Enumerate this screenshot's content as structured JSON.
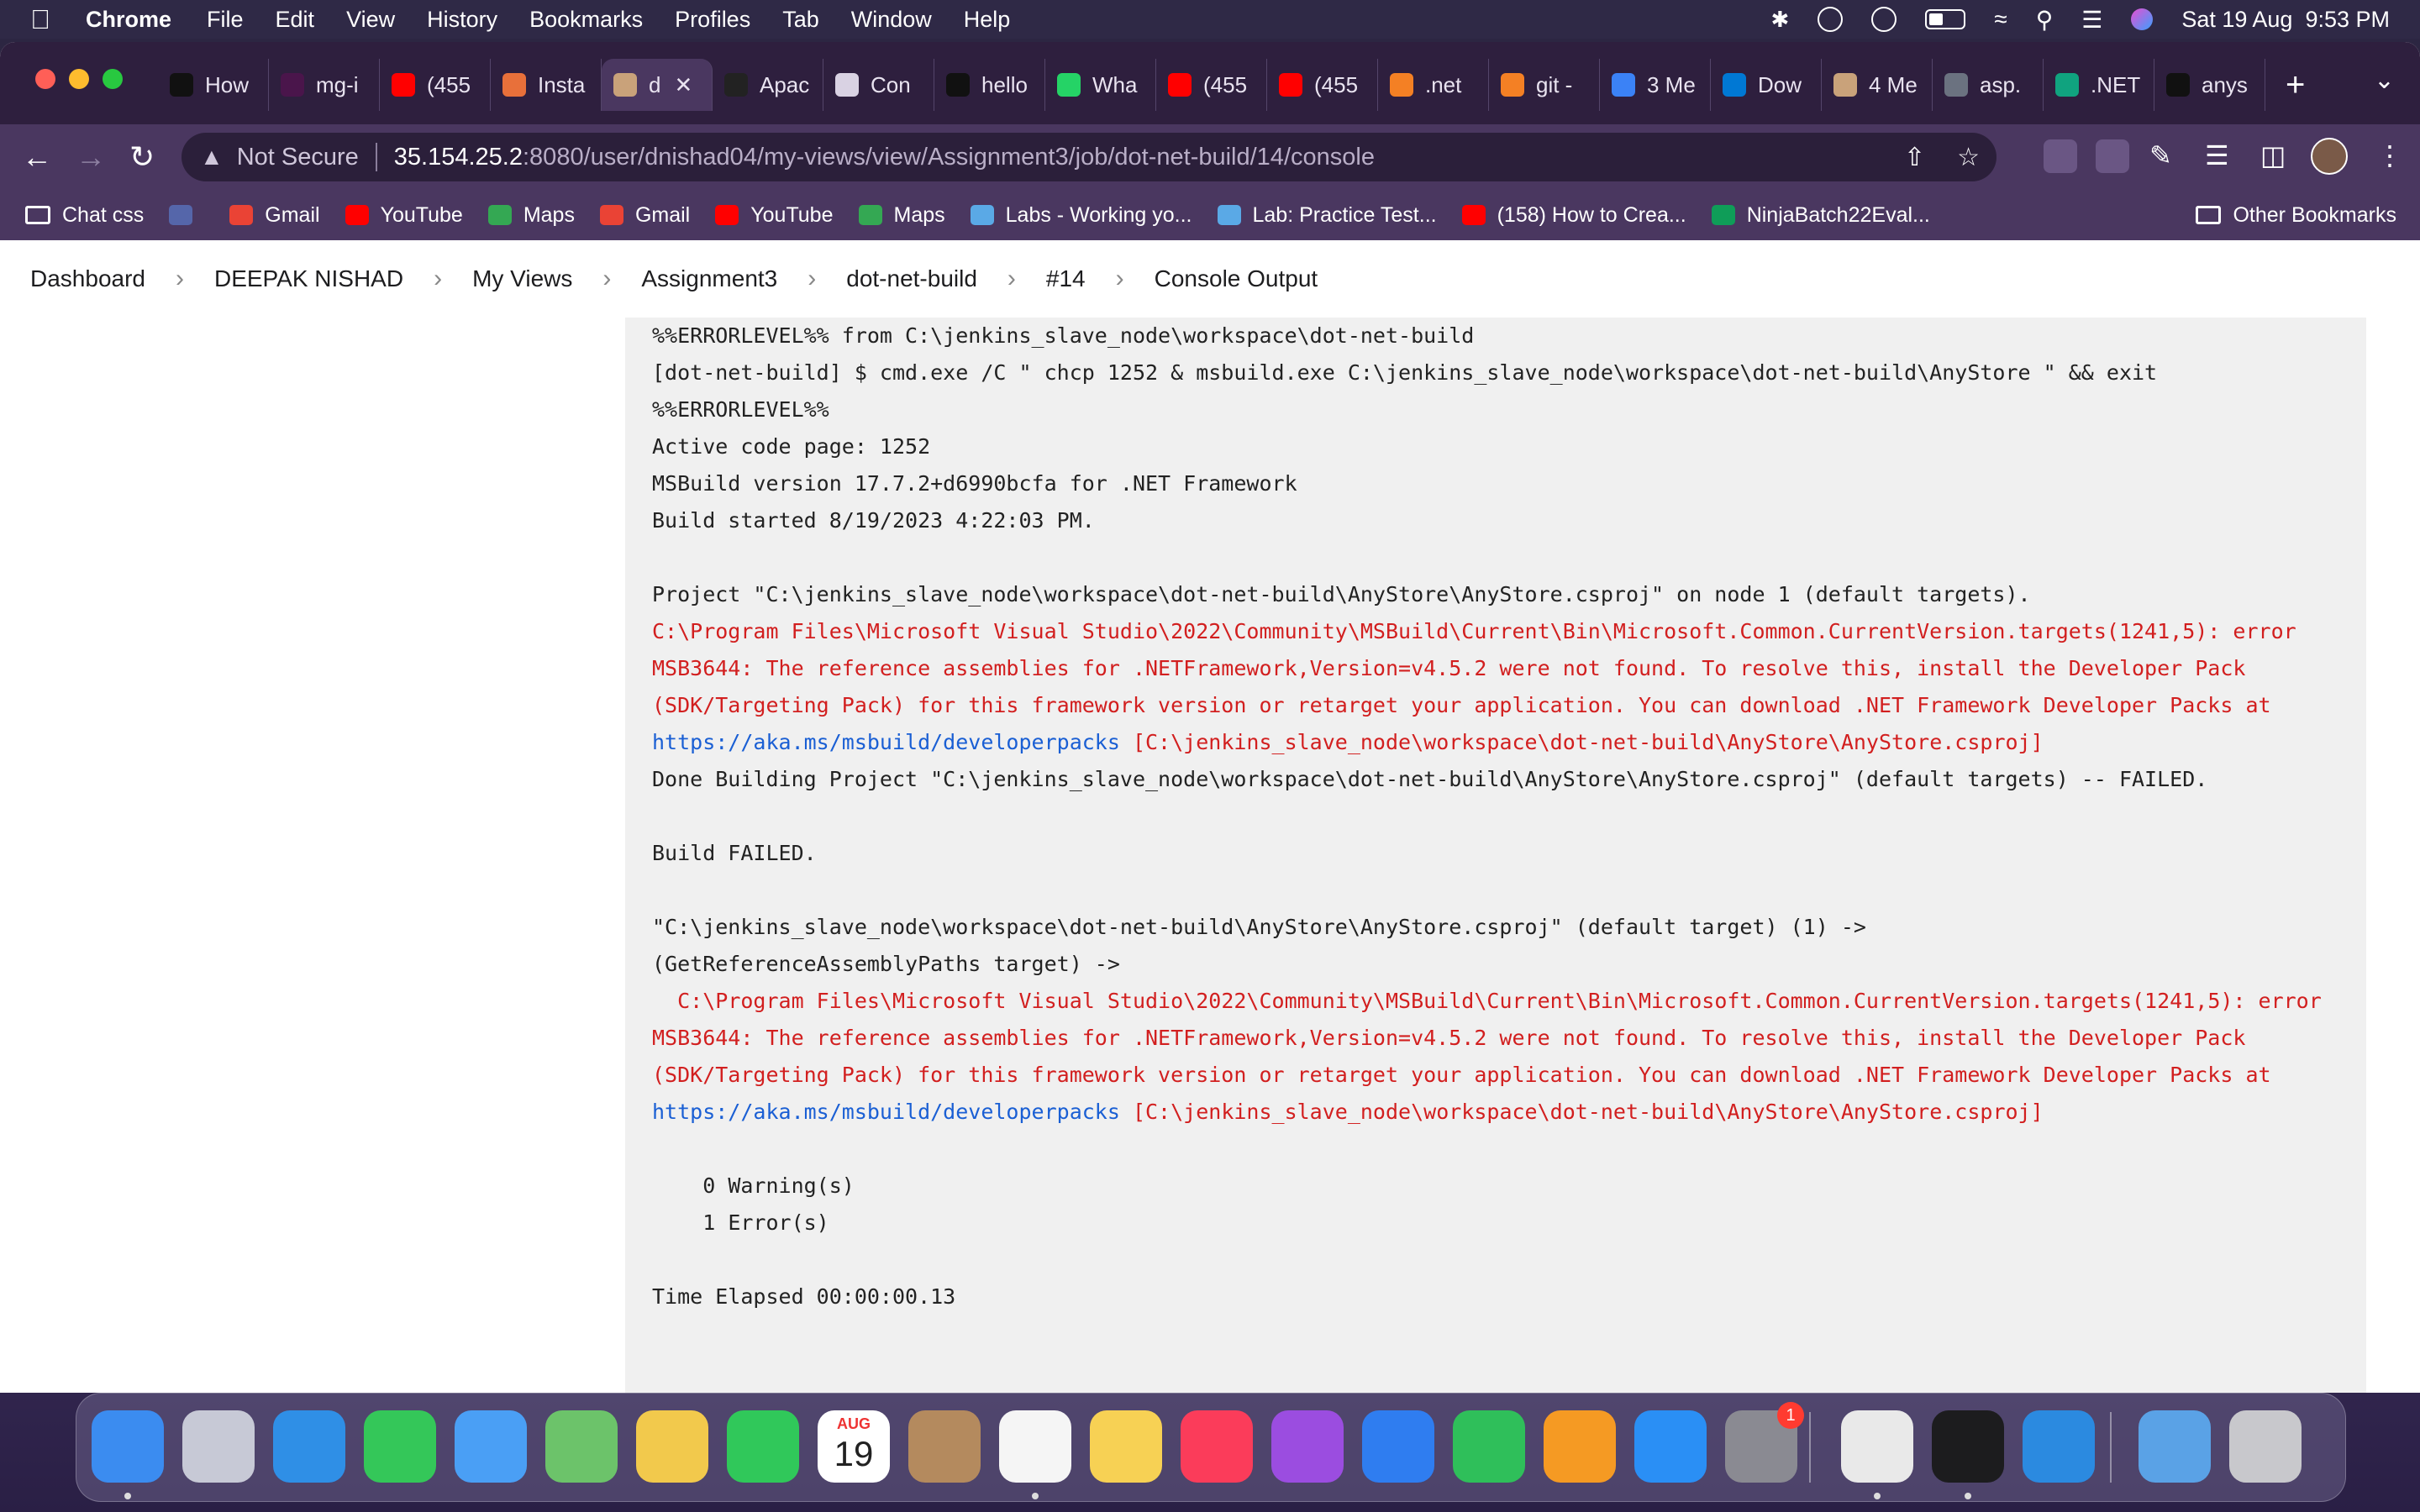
{
  "menubar": {
    "app": "Chrome",
    "items": [
      "File",
      "Edit",
      "View",
      "History",
      "Bookmarks",
      "Profiles",
      "Tab",
      "Window",
      "Help"
    ],
    "clock": "Sat 19 Aug  9:53 PM"
  },
  "tabs": [
    {
      "label": "How",
      "color": "#111111"
    },
    {
      "label": "mg-i",
      "color": "#4a154b"
    },
    {
      "label": "(455",
      "color": "#ff0000"
    },
    {
      "label": "Insta",
      "color": "#e8703a"
    },
    {
      "label": "d",
      "color": "#c9a27a",
      "active": true
    },
    {
      "label": "Apac",
      "color": "#222222"
    },
    {
      "label": "Con",
      "color": "#d9d2e3"
    },
    {
      "label": "hello",
      "color": "#111111"
    },
    {
      "label": "Wha",
      "color": "#25d366"
    },
    {
      "label": "(455",
      "color": "#ff0000"
    },
    {
      "label": "(455",
      "color": "#ff0000"
    },
    {
      "label": ".net",
      "color": "#f48024"
    },
    {
      "label": "git -",
      "color": "#f48024"
    },
    {
      "label": "3 Me",
      "color": "#3b82f6"
    },
    {
      "label": "Dow",
      "color": "#0078d4"
    },
    {
      "label": "4 Me",
      "color": "#c9a27a"
    },
    {
      "label": "asp.",
      "color": "#6b7280"
    },
    {
      "label": ".NET",
      "color": "#10a37f"
    },
    {
      "label": "anys",
      "color": "#111111"
    }
  ],
  "tab_close": "✕",
  "new_tab": "+",
  "address": {
    "security": "Not Secure",
    "host": "35.154.25.2",
    "path": ":8080/user/dnishad04/my-views/view/Assignment3/job/dot-net-build/14/console"
  },
  "bookmarks": [
    {
      "label": "Chat css",
      "color": "folder"
    },
    {
      "label": "",
      "color": "#5566aa"
    },
    {
      "label": "Gmail",
      "color": "#ea4335"
    },
    {
      "label": "YouTube",
      "color": "#ff0000"
    },
    {
      "label": "Maps",
      "color": "#34a853"
    },
    {
      "label": "Gmail",
      "color": "#ea4335"
    },
    {
      "label": "YouTube",
      "color": "#ff0000"
    },
    {
      "label": "Maps",
      "color": "#34a853"
    },
    {
      "label": "Labs - Working yo...",
      "color": "#5aa9e6"
    },
    {
      "label": "Lab: Practice Test...",
      "color": "#5aa9e6"
    },
    {
      "label": "(158) How to Crea...",
      "color": "#ff0000"
    },
    {
      "label": "NinjaBatch22Eval...",
      "color": "#0f9d58"
    }
  ],
  "other_bookmarks": "Other Bookmarks",
  "breadcrumb": [
    "Dashboard",
    "DEEPAK NISHAD",
    "My Views",
    "Assignment3",
    "dot-net-build",
    "#14",
    "Console Output"
  ],
  "console": {
    "l1": "%%ERRORLEVEL%% from C:\\jenkins_slave_node\\workspace\\dot-net-build",
    "l2": "[dot-net-build] $ cmd.exe /C \" chcp 1252 & msbuild.exe C:\\jenkins_slave_node\\workspace\\dot-net-build\\AnyStore \" && exit",
    "l3": "%%ERRORLEVEL%%",
    "l4": "Active code page: 1252",
    "l5": "MSBuild version 17.7.2+d6990bcfa for .NET Framework",
    "l6": "Build started 8/19/2023 4:22:03 PM.",
    "l7": "Project \"C:\\jenkins_slave_node\\workspace\\dot-net-build\\AnyStore\\AnyStore.csproj\" on node 1 (default targets).",
    "e1a": "C:\\Program Files\\Microsoft Visual Studio\\2022\\Community\\MSBuild\\Current\\Bin\\Microsoft.Common.CurrentVersion.targets(1241,5): error MSB3644: The reference assemblies for .NETFramework,Version=v4.5.2 were not found. To resolve this, install the Developer Pack (SDK/Targeting Pack) for this framework version or retarget your application. You can download .NET Framework Developer Packs at ",
    "e1link": "https://aka.ms/msbuild/developerpacks",
    "e1b": " [C:\\jenkins_slave_node\\workspace\\dot-net-build\\AnyStore\\AnyStore.csproj]",
    "l8": "Done Building Project \"C:\\jenkins_slave_node\\workspace\\dot-net-build\\AnyStore\\AnyStore.csproj\" (default targets) -- FAILED.",
    "l9": "Build FAILED.",
    "l10": "\"C:\\jenkins_slave_node\\workspace\\dot-net-build\\AnyStore\\AnyStore.csproj\" (default target) (1) ->",
    "l11": "(GetReferenceAssemblyPaths target) ->",
    "e2a": "  C:\\Program Files\\Microsoft Visual Studio\\2022\\Community\\MSBuild\\Current\\Bin\\Microsoft.Common.CurrentVersion.targets(1241,5): error MSB3644: The reference assemblies for .NETFramework,Version=v4.5.2 were not found. To resolve this, install the Developer Pack (SDK/Targeting Pack) for this framework version or retarget your application. You can download .NET Framework Developer Packs at ",
    "e2link": "https://aka.ms/msbuild/developerpacks",
    "e2b": " [C:\\jenkins_slave_node\\workspace\\dot-net-build\\AnyStore\\AnyStore.csproj]",
    "l12": "    0 Warning(s)",
    "l13": "    1 Error(s)",
    "l14": "Time Elapsed 00:00:00.13"
  },
  "dock": {
    "apps": [
      {
        "name": "finder",
        "color": "#3b8cf0"
      },
      {
        "name": "launchpad",
        "color": "#c7c9d6"
      },
      {
        "name": "safari",
        "color": "#2f8fe6"
      },
      {
        "name": "messages",
        "color": "#34c759"
      },
      {
        "name": "mail",
        "color": "#4a9ff5"
      },
      {
        "name": "maps",
        "color": "#6cc36a"
      },
      {
        "name": "photos",
        "color": "#f2c94c"
      },
      {
        "name": "facetime",
        "color": "#30c85a"
      },
      {
        "name": "calendar",
        "color": "#ffffff"
      },
      {
        "name": "contacts",
        "color": "#b48a5e"
      },
      {
        "name": "reminders",
        "color": "#f5f5f5"
      },
      {
        "name": "notes",
        "color": "#f7d154"
      },
      {
        "name": "music",
        "color": "#fb3c5a"
      },
      {
        "name": "podcasts",
        "color": "#9b4de0"
      },
      {
        "name": "keynote",
        "color": "#2f7df0"
      },
      {
        "name": "numbers",
        "color": "#2fbf5a"
      },
      {
        "name": "pages",
        "color": "#f59a23"
      },
      {
        "name": "app-store",
        "color": "#2a8ff5"
      },
      {
        "name": "system-settings",
        "color": "#8a8a92"
      },
      {
        "name": "chrome",
        "color": "#e9e9e9"
      },
      {
        "name": "terminal",
        "color": "#1c1c1e"
      },
      {
        "name": "vscode",
        "color": "#2b8ae0"
      },
      {
        "name": "downloads",
        "color": "#5aa2e6"
      },
      {
        "name": "trash",
        "color": "#c8c8cc"
      }
    ],
    "calendar_month": "AUG",
    "calendar_day": "19",
    "settings_badge": "1"
  }
}
